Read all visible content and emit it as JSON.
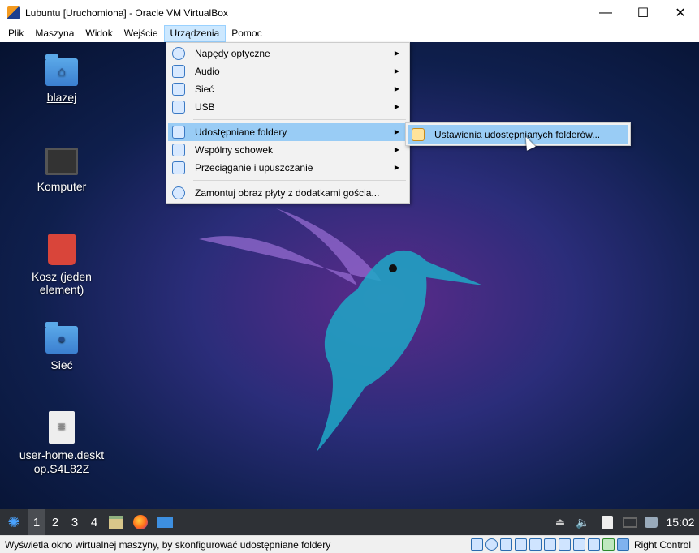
{
  "window": {
    "title": "Lubuntu [Uruchomiona] - Oracle VM VirtualBox",
    "minimize": "—",
    "maximize": "☐",
    "close": "✕"
  },
  "menubar": [
    "Plik",
    "Maszyna",
    "Widok",
    "Wejście",
    "Urządzenia",
    "Pomoc"
  ],
  "devices_menu": {
    "items": [
      {
        "label": "Napędy optyczne",
        "icon": "optical-disc-icon",
        "submenu": true
      },
      {
        "label": "Audio",
        "icon": "audio-icon",
        "submenu": true
      },
      {
        "label": "Sieć",
        "icon": "network-icon",
        "submenu": true
      },
      {
        "label": "USB",
        "icon": "usb-icon",
        "submenu": true
      },
      {
        "label": "Udostępniane foldery",
        "icon": "shared-folder-icon",
        "submenu": true,
        "selected": true
      },
      {
        "label": "Wspólny schowek",
        "icon": "clipboard-icon",
        "submenu": true
      },
      {
        "label": "Przeciąganie i upuszczanie",
        "icon": "drag-drop-icon",
        "submenu": true
      },
      {
        "label": "Zamontuj obraz płyty z dodatkami gościa...",
        "icon": "guest-additions-icon",
        "submenu": false
      }
    ],
    "arrow": "▶"
  },
  "shared_folders_submenu": {
    "label": "Ustawienia udostępnianych folderów..."
  },
  "desktop_icons": [
    {
      "label": "blazej",
      "glyph": "⌂"
    },
    {
      "label": "Komputer"
    },
    {
      "label": "Kosz (jeden element)"
    },
    {
      "label": "Sieć",
      "glyph": "●"
    },
    {
      "label": "user-home.desktop.S4L82Z",
      "glyph": "≡"
    }
  ],
  "taskbar": {
    "workspaces": [
      "1",
      "2",
      "3",
      "4"
    ],
    "active_workspace": "1",
    "clock": "15:02"
  },
  "status": {
    "text": "Wyświetla okno wirtualnej maszyny, by skonfigurować udostępniane foldery",
    "host_key": "Right Control"
  }
}
